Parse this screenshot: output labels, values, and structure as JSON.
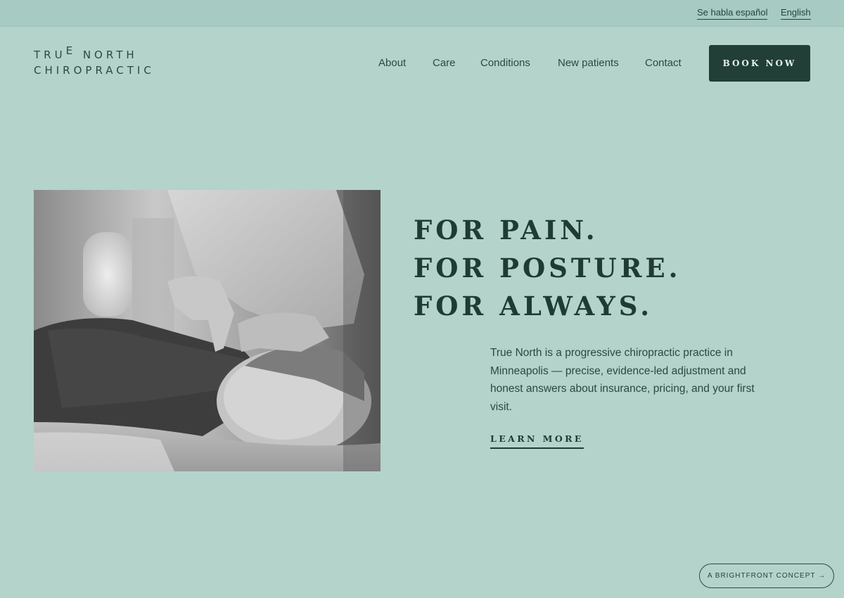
{
  "topbar": {
    "lang_es": "Se habla español",
    "lang_en": "English"
  },
  "logo": {
    "line1_a": "TRU",
    "line1_e": "E",
    "line1_b": " NORTH",
    "line2": "CHIROPRACTIC"
  },
  "nav": {
    "items": [
      "About",
      "Care",
      "Conditions",
      "New patients",
      "Contact"
    ],
    "cta": "BOOK NOW"
  },
  "hero": {
    "headline": [
      "FOR PAIN.",
      "FOR POSTURE.",
      "FOR ALWAYS."
    ],
    "intro": "True North is a progressive chiropractic practice in Minneapolis — precise, evidence-led adjustment and honest answers about insurance, pricing, and your first visit.",
    "learn_more": "LEARN MORE"
  },
  "badge": {
    "label": "A BRIGHTFRONT CONCEPT →"
  },
  "colors": {
    "background": "#b3d3cb",
    "topbar": "#a7cac2",
    "accent_dark": "#213f37",
    "text": "#1f3b34"
  }
}
